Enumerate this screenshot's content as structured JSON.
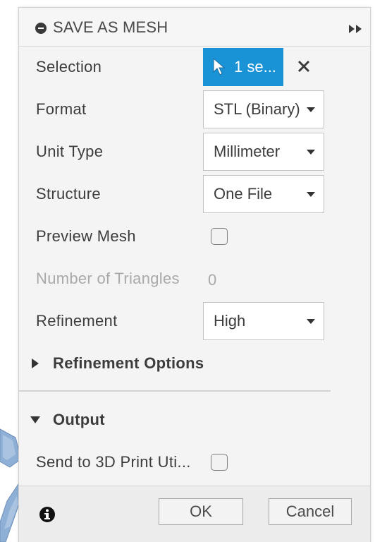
{
  "dialog": {
    "title": "SAVE AS MESH",
    "title_icon": "minus-circle-icon",
    "expand_icon": "double-chevron-right-icon"
  },
  "rows": {
    "selection": {
      "label": "Selection",
      "button_text": "1 se...",
      "button_icon": "cursor-arrow-icon",
      "clear_icon": "close-icon"
    },
    "format": {
      "label": "Format",
      "value": "STL (Binary)"
    },
    "unit_type": {
      "label": "Unit Type",
      "value": "Millimeter"
    },
    "structure": {
      "label": "Structure",
      "value": "One File"
    },
    "preview_mesh": {
      "label": "Preview Mesh",
      "checked": false
    },
    "num_triangles": {
      "label": "Number of Triangles",
      "value": "0"
    },
    "refinement": {
      "label": "Refinement",
      "value": "High"
    }
  },
  "sections": {
    "refinement_options": {
      "label": "Refinement Options",
      "expanded": false
    },
    "output": {
      "label": "Output",
      "expanded": true,
      "send_to_print": {
        "label": "Send to 3D Print Uti...",
        "checked": false
      }
    }
  },
  "footer": {
    "info_icon": "info-icon",
    "ok_label": "OK",
    "cancel_label": "Cancel"
  },
  "colors": {
    "accent": "#1a93d6",
    "panel_bg": "#f4f4f4",
    "disabled_text": "#a9a9a9"
  }
}
